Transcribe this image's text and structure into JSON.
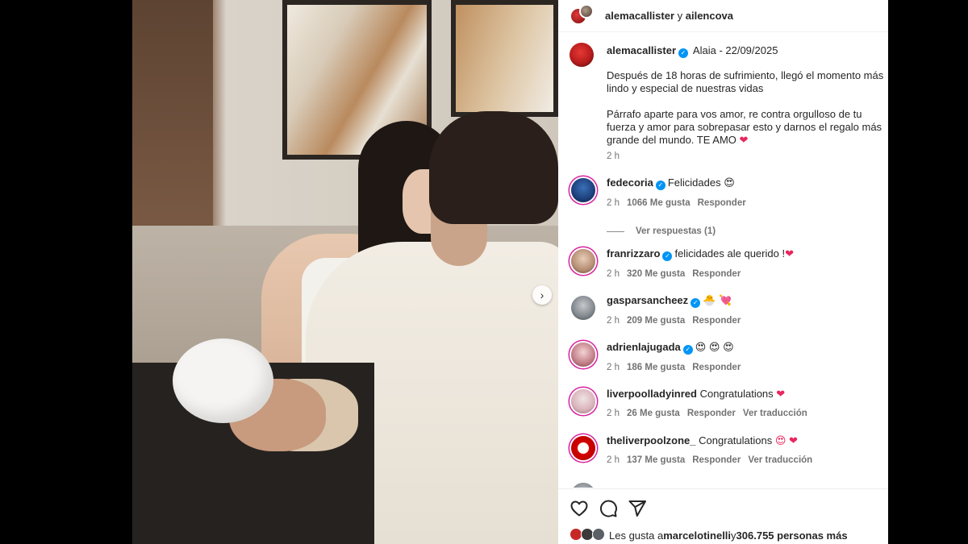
{
  "header": {
    "user1": "alemacallister",
    "sep": " y ",
    "user2": "ailencova"
  },
  "caption": {
    "username": "alemacallister",
    "title": "Alaia - 22/09/2025",
    "para1": "Después de 18 horas de sufrimiento, llegó el momento más lindo y especial de nuestras vidas",
    "para2": "Párrafo aparte para vos amor, re contra orgulloso de tu fuerza y amor para sobrepasar esto y darnos el regalo más grande del mundo. TE AMO",
    "para2_emoji": "❤",
    "time": "2 h"
  },
  "comments": [
    {
      "username": "fedecoria",
      "verified": true,
      "text": "Felicidades",
      "emoji": "😍",
      "time": "2 h",
      "likes": "1066 Me gusta",
      "reply": "Responder",
      "translate": "",
      "avatar": "blue"
    },
    {
      "username": "franrizzaro",
      "verified": true,
      "text": "felicidades ale querido !",
      "emoji": "❤",
      "time": "2 h",
      "likes": "320 Me gusta",
      "reply": "Responder",
      "translate": "",
      "avatar": "skin"
    },
    {
      "username": "gasparsancheez",
      "verified": true,
      "text": "",
      "emoji": "🐣 💘",
      "time": "2 h",
      "likes": "209 Me gusta",
      "reply": "Responder",
      "translate": "",
      "avatar": "grey"
    },
    {
      "username": "adrienlajugada",
      "verified": true,
      "text": "",
      "emoji": "😍 😍 😍",
      "time": "2 h",
      "likes": "186 Me gusta",
      "reply": "Responder",
      "translate": "",
      "avatar": "pink"
    },
    {
      "username": "liverpoolladyinred",
      "verified": false,
      "text": "Congratulations",
      "emoji": "❤",
      "time": "2 h",
      "likes": "26 Me gusta",
      "reply": "Responder",
      "translate": "Ver traducción",
      "avatar": "rose"
    },
    {
      "username": "theliverpoolzone_",
      "verified": false,
      "text": "Congratulations",
      "emoji": "😍 ❤",
      "time": "2 h",
      "likes": "137 Me gusta",
      "reply": "Responder",
      "translate": "Ver traducción",
      "avatar": "lfc"
    }
  ],
  "view_replies": "Ver respuestas (1)",
  "likes_bar": {
    "prefix": "Les gusta a ",
    "user": "marcelotinelli",
    "mid": " y ",
    "count": "306.755 personas más"
  },
  "colors": {
    "verified": "#0095f6",
    "heart": "#e8265e",
    "story_ring": "#d6249f"
  },
  "icons": {
    "like": "heart-outline-icon",
    "comment": "speech-bubble-icon",
    "share": "paper-plane-icon",
    "next": "chevron-right-icon"
  }
}
